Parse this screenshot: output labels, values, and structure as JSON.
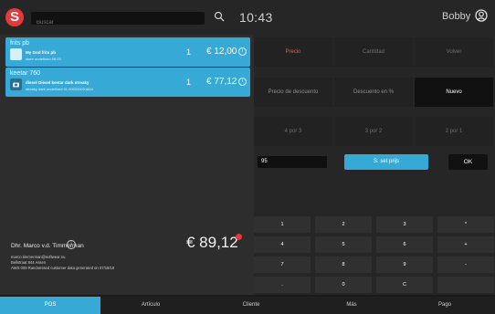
{
  "header": {
    "logo_letter": "S",
    "search_placeholder": "Buscar",
    "time": "10:43",
    "user_name": "Bobby"
  },
  "cart": {
    "items": [
      {
        "title": "frits pb",
        "line1": "My God frits pb",
        "line2": "store undefined 08 93",
        "qty": "1",
        "price": "€ 12,00"
      },
      {
        "title": "keetar 760",
        "line1": "diesel Diesel keetar dark streaky",
        "line2": "streaky dark undefined 01 000033001824",
        "qty": "1",
        "price": "€ 77,12"
      }
    ],
    "total": "€ 89,12"
  },
  "customer": {
    "name": "Dhr. Marco v.d. Timmerman",
    "email": "marco.timmerman@softwear.nu",
    "address": "Bellstraat 844 Assen",
    "note": "AWS 008 Randomised customer data generated on 07/18/19"
  },
  "functions": {
    "row1": [
      "Precio",
      "Cantidad",
      "Volver"
    ],
    "row2": [
      "Precio de descuento",
      "Descuento en %",
      "Nuevo"
    ],
    "row3": [
      "4 por 3",
      "3 por 2",
      "2 por 1"
    ]
  },
  "price_input": {
    "value": "95"
  },
  "actions": {
    "set_price": "S. set prijs",
    "ok": "OK"
  },
  "keypad": {
    "rows": [
      [
        "1",
        "2",
        "3",
        "*"
      ],
      [
        "4",
        "5",
        "6",
        "+"
      ],
      [
        "7",
        "8",
        "9",
        "-"
      ],
      [
        ".",
        "0",
        "C",
        ""
      ]
    ]
  },
  "nav": {
    "items": [
      "POS",
      "Artículo",
      "Cliente",
      "Más",
      "Pago"
    ],
    "active_index": 0
  },
  "colors": {
    "accent": "#36a9d6",
    "brand_red": "#e53a3a"
  }
}
